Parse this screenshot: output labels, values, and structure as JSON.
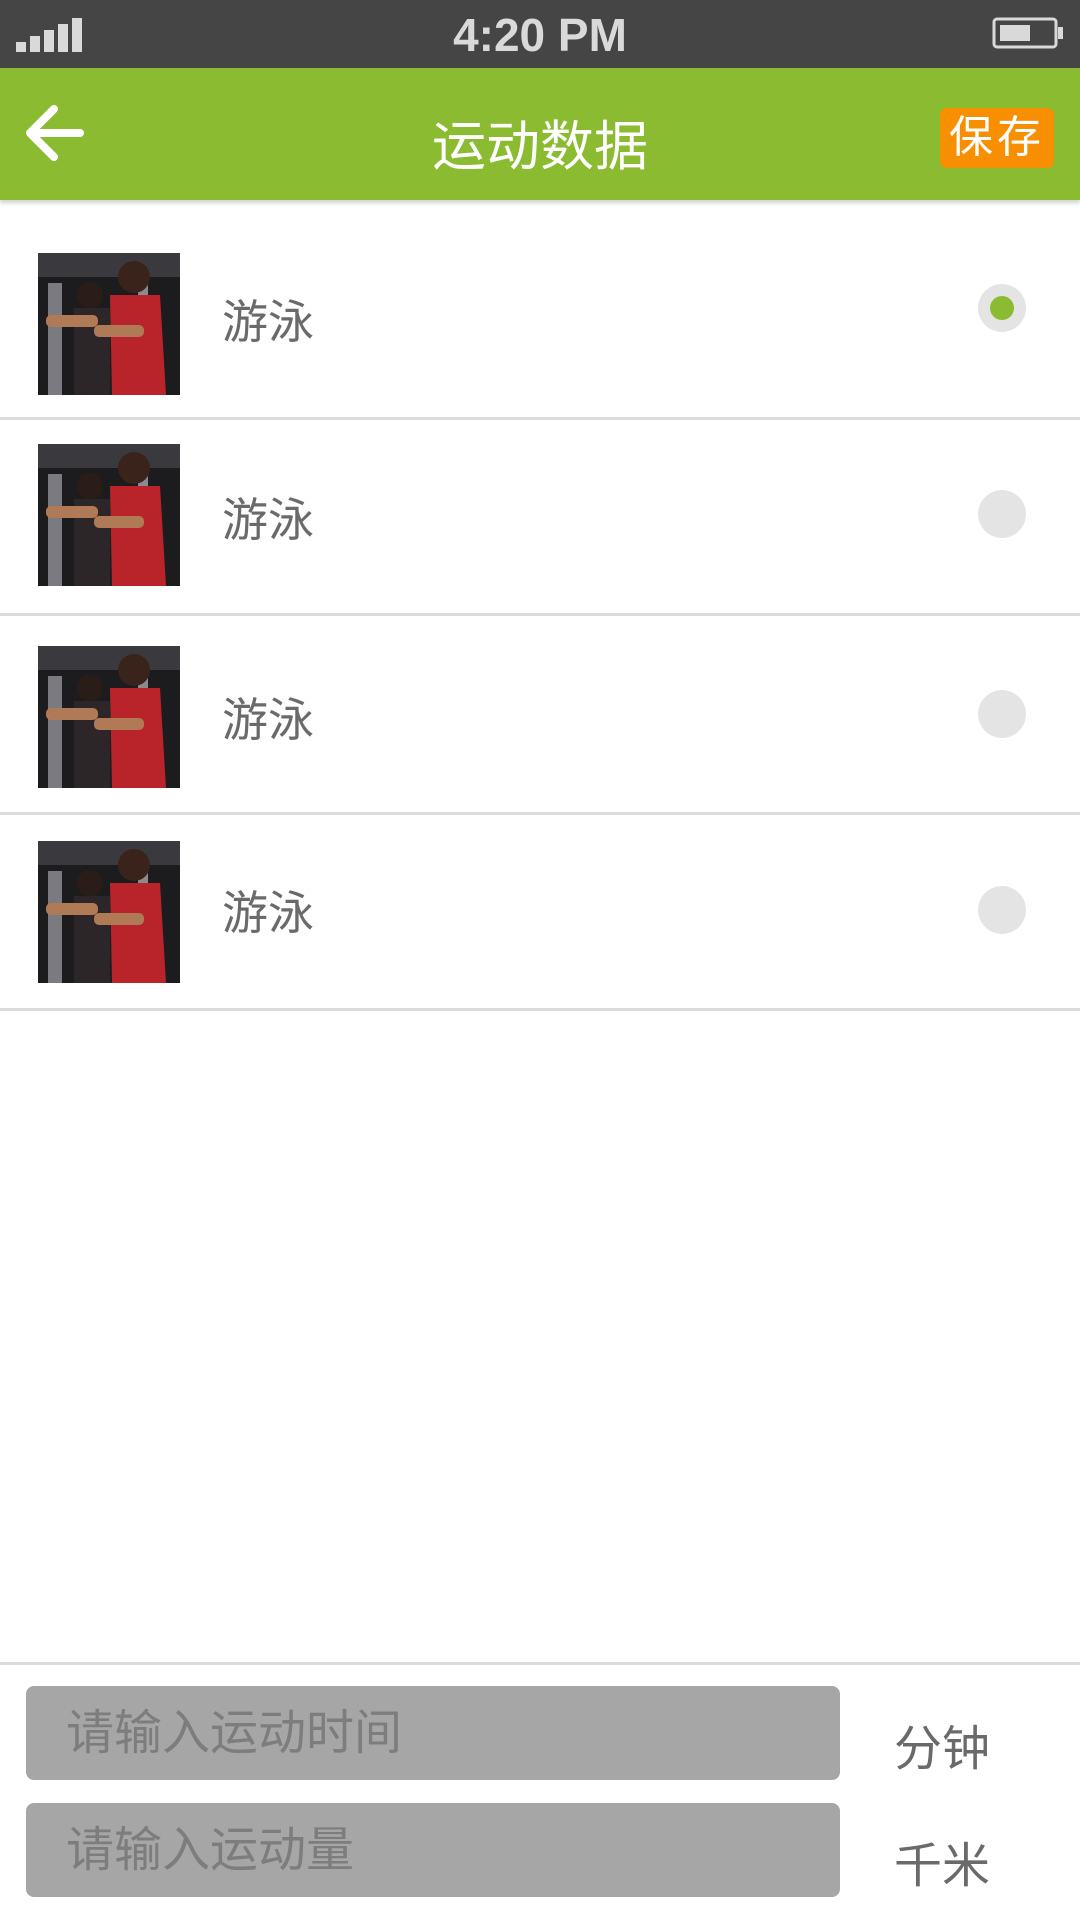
{
  "status_bar": {
    "time": "4:20 PM",
    "signal_icon": "signal-bars-icon",
    "battery_icon": "battery-icon"
  },
  "header": {
    "title": "运动数据",
    "save_label": "保存",
    "back_icon": "arrow-left-icon",
    "bar_color": "#8abb30",
    "save_color": "#f78f00"
  },
  "exercise_list": {
    "items": [
      {
        "label": "游泳",
        "selected": true
      },
      {
        "label": "游泳",
        "selected": false
      },
      {
        "label": "游泳",
        "selected": false
      },
      {
        "label": "游泳",
        "selected": false
      }
    ]
  },
  "inputs": {
    "time": {
      "placeholder": "请输入运动时间",
      "value": "",
      "unit": "分钟"
    },
    "amount": {
      "placeholder": "请输入运动量",
      "value": "",
      "unit": "千米"
    }
  }
}
